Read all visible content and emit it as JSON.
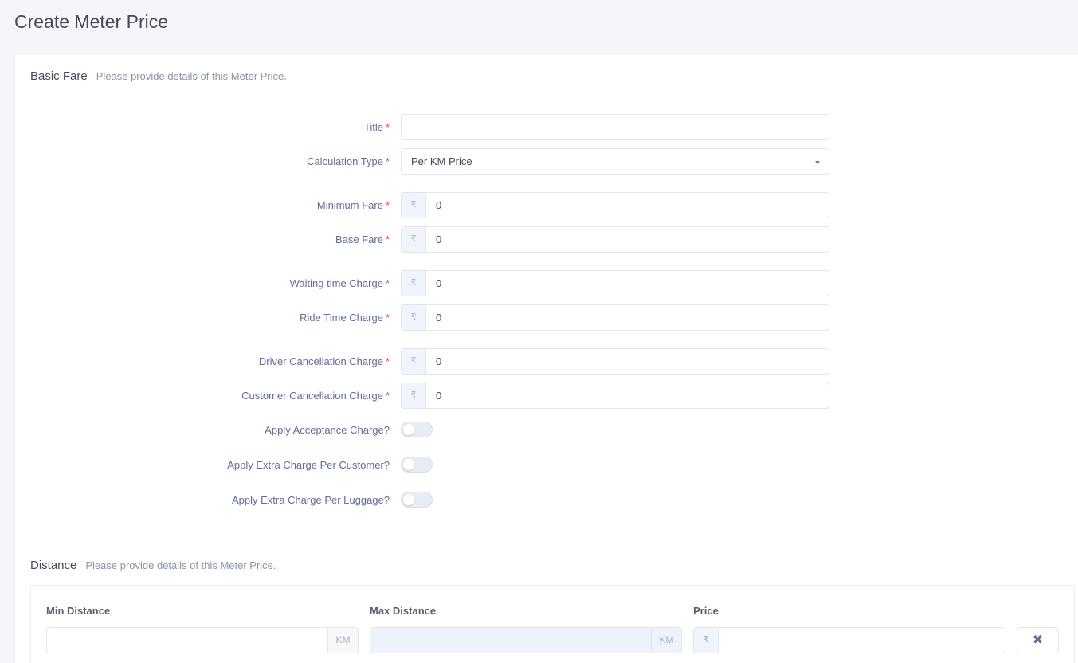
{
  "page": {
    "title": "Create Meter Price"
  },
  "basic_fare": {
    "title": "Basic Fare",
    "subtitle": "Please provide details of this Meter Price.",
    "required_mark": "*",
    "currency_symbol": "₹",
    "fields": {
      "title": {
        "label": "Title",
        "value": ""
      },
      "calculation_type": {
        "label": "Calculation Type",
        "value": "Per KM Price"
      },
      "minimum_fare": {
        "label": "Minimum Fare",
        "value": "0"
      },
      "base_fare": {
        "label": "Base Fare",
        "value": "0"
      },
      "waiting_time_charge": {
        "label": "Waiting time Charge",
        "value": "0"
      },
      "ride_time_charge": {
        "label": "Ride Time Charge",
        "value": "0"
      },
      "driver_cancellation_charge": {
        "label": "Driver Cancellation Charge",
        "value": "0"
      },
      "customer_cancellation_charge": {
        "label": "Customer Cancellation Charge",
        "value": "0"
      }
    },
    "toggles": {
      "acceptance_charge": {
        "label": "Apply Acceptance Charge?",
        "on": false
      },
      "extra_per_customer": {
        "label": "Apply Extra Charge Per Customer?",
        "on": false
      },
      "extra_per_luggage": {
        "label": "Apply Extra Charge Per Luggage?",
        "on": false
      }
    }
  },
  "distance": {
    "title": "Distance",
    "subtitle": "Please provide details of this Meter Price.",
    "columns": {
      "min": "Min Distance",
      "max": "Max Distance",
      "price": "Price"
    },
    "unit": "KM",
    "currency_symbol": "₹",
    "delete_icon": "close-icon",
    "delete_glyph": "✖"
  },
  "colors": {
    "accent": "#fd397a",
    "background": "#f5f6fa",
    "input_border": "#e2e5ec"
  }
}
